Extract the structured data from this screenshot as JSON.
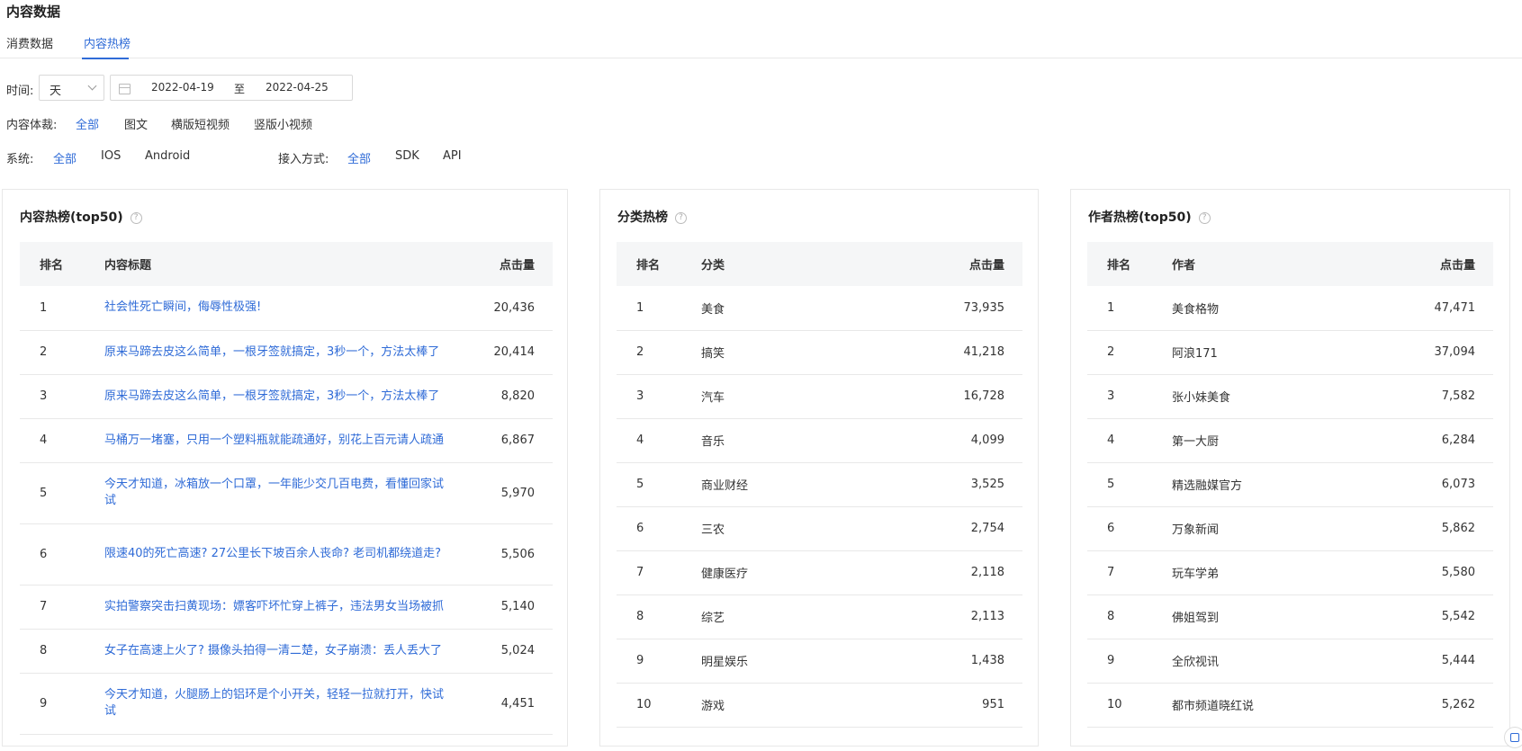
{
  "page_title": "内容数据",
  "tabs": [
    {
      "label": "消费数据",
      "active": false
    },
    {
      "label": "内容热榜",
      "active": true
    }
  ],
  "filters": {
    "time_label": "时间:",
    "time_unit": "天",
    "date_start": "2022-04-19",
    "date_sep": "至",
    "date_end": "2022-04-25",
    "genre_label": "内容体裁:",
    "genre_options": [
      "全部",
      "图文",
      "横版短视频",
      "竖版小视频"
    ],
    "system_label": "系统:",
    "system_options": [
      "全部",
      "IOS",
      "Android"
    ],
    "access_label": "接入方式:",
    "access_options": [
      "全部",
      "SDK",
      "API"
    ]
  },
  "panels": {
    "content": {
      "title": "内容热榜(top50)",
      "headers": [
        "排名",
        "内容标题",
        "点击量"
      ],
      "rows": [
        {
          "rank": "1",
          "name": "社会性死亡瞬间，侮辱性极强!",
          "clicks": "20,436"
        },
        {
          "rank": "2",
          "name": "原来马蹄去皮这么简单，一根牙签就搞定，3秒一个，方法太棒了",
          "clicks": "20,414"
        },
        {
          "rank": "3",
          "name": "原来马蹄去皮这么简单，一根牙签就搞定，3秒一个，方法太棒了",
          "clicks": "8,820"
        },
        {
          "rank": "4",
          "name": "马桶万一堵塞，只用一个塑料瓶就能疏通好，别花上百元请人疏通",
          "clicks": "6,867"
        },
        {
          "rank": "5",
          "name": "今天才知道，冰箱放一个口罩，一年能少交几百电费，看懂回家试试",
          "clicks": "5,970"
        },
        {
          "rank": "6",
          "name": "限速40的死亡高速? 27公里长下坡百余人丧命? 老司机都绕道走?",
          "clicks": "5,506"
        },
        {
          "rank": "7",
          "name": "实拍警察突击扫黄现场：嫖客吓坏忙穿上裤子，违法男女当场被抓",
          "clicks": "5,140"
        },
        {
          "rank": "8",
          "name": "女子在高速上火了? 摄像头拍得一清二楚，女子崩溃：丢人丢大了",
          "clicks": "5,024"
        },
        {
          "rank": "9",
          "name": "今天才知道，火腿肠上的铝环是个小开关，轻轻一拉就打开，快试试",
          "clicks": "4,451"
        }
      ]
    },
    "category": {
      "title": "分类热榜",
      "headers": [
        "排名",
        "分类",
        "点击量"
      ],
      "rows": [
        {
          "rank": "1",
          "name": "美食",
          "clicks": "73,935"
        },
        {
          "rank": "2",
          "name": "搞笑",
          "clicks": "41,218"
        },
        {
          "rank": "3",
          "name": "汽车",
          "clicks": "16,728"
        },
        {
          "rank": "4",
          "name": "音乐",
          "clicks": "4,099"
        },
        {
          "rank": "5",
          "name": "商业财经",
          "clicks": "3,525"
        },
        {
          "rank": "6",
          "name": "三农",
          "clicks": "2,754"
        },
        {
          "rank": "7",
          "name": "健康医疗",
          "clicks": "2,118"
        },
        {
          "rank": "8",
          "name": "综艺",
          "clicks": "2,113"
        },
        {
          "rank": "9",
          "name": "明星娱乐",
          "clicks": "1,438"
        },
        {
          "rank": "10",
          "name": "游戏",
          "clicks": "951"
        }
      ]
    },
    "author": {
      "title": "作者热榜(top50)",
      "headers": [
        "排名",
        "作者",
        "点击量"
      ],
      "rows": [
        {
          "rank": "1",
          "name": "美食格物",
          "clicks": "47,471"
        },
        {
          "rank": "2",
          "name": "阿浪171",
          "clicks": "37,094"
        },
        {
          "rank": "3",
          "name": "张小妹美食",
          "clicks": "7,582"
        },
        {
          "rank": "4",
          "name": "第一大厨",
          "clicks": "6,284"
        },
        {
          "rank": "5",
          "name": "精选融媒官方",
          "clicks": "6,073"
        },
        {
          "rank": "6",
          "name": "万象新闻",
          "clicks": "5,862"
        },
        {
          "rank": "7",
          "name": "玩车学弟",
          "clicks": "5,580"
        },
        {
          "rank": "8",
          "name": "佛姐驾到",
          "clicks": "5,542"
        },
        {
          "rank": "9",
          "name": "全欣视讯",
          "clicks": "5,444"
        },
        {
          "rank": "10",
          "name": "都市频道晓红说",
          "clicks": "5,262"
        }
      ]
    }
  },
  "colors": {
    "accent": "#2f6bd7",
    "header_bg": "#f5f6f7",
    "border": "#e8e8e8"
  }
}
